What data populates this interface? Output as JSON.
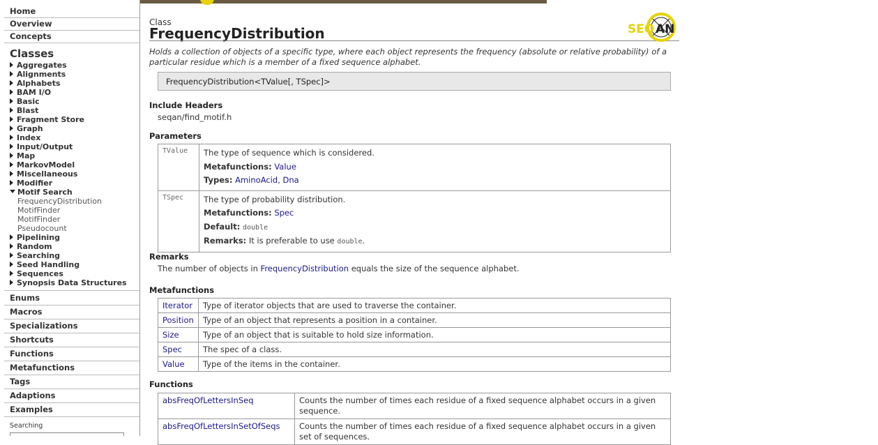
{
  "sidebar": {
    "top": [
      "Home",
      "Overview",
      "Concepts"
    ],
    "classes_heading": "Classes",
    "classes": [
      {
        "label": "Aggregates",
        "open": false
      },
      {
        "label": "Alignments",
        "open": false
      },
      {
        "label": "Alphabets",
        "open": false
      },
      {
        "label": "BAM I/O",
        "open": false
      },
      {
        "label": "Basic",
        "open": false
      },
      {
        "label": "Blast",
        "open": false
      },
      {
        "label": "Fragment Store",
        "open": false
      },
      {
        "label": "Graph",
        "open": false
      },
      {
        "label": "Index",
        "open": false
      },
      {
        "label": "Input/Output",
        "open": false
      },
      {
        "label": "Map",
        "open": false
      },
      {
        "label": "MarkovModel",
        "open": false
      },
      {
        "label": "Miscellaneous",
        "open": false
      },
      {
        "label": "Modifier",
        "open": false
      },
      {
        "label": "Motif Search",
        "open": true
      },
      {
        "label": "Pipelining",
        "open": false
      },
      {
        "label": "Random",
        "open": false
      },
      {
        "label": "Searching",
        "open": false
      },
      {
        "label": "Seed Handling",
        "open": false
      },
      {
        "label": "Sequences",
        "open": false
      },
      {
        "label": "Synopsis Data Structures",
        "open": false
      }
    ],
    "motif_children": [
      "FrequencyDistribution",
      "MotifFinder",
      "MotifFinder",
      "Pseudocount"
    ],
    "bottom": [
      "Enums",
      "Macros",
      "Specializations",
      "Shortcuts",
      "Functions",
      "Metafunctions",
      "Tags",
      "Adaptions",
      "Examples"
    ],
    "search_label": "Searching"
  },
  "page": {
    "kind": "Class",
    "title": "FrequencyDistribution",
    "logo_text": "SEQAN",
    "description": "Holds a collection of objects of a specific type, where each object represents the frequency (absolute or relative probability) of a particular residue which is a member of a fixed sequence alphabet.",
    "signature": "FrequencyDistribution<TValue[, TSpec]>",
    "include_heading": "Include Headers",
    "include_value": "seqan/find_motif.h",
    "params_heading": "Parameters",
    "params": {
      "tvalue": {
        "name": "TValue",
        "desc": "The type of sequence which is considered.",
        "mf_label": "Metafunctions:",
        "mf_link": "Value",
        "types_label": "Types:",
        "type1": "AminoAcid",
        "sep": ", ",
        "type2": "Dna"
      },
      "tspec": {
        "name": "TSpec",
        "desc": "The type of probability distribution.",
        "mf_label": "Metafunctions:",
        "mf_link": "Spec",
        "default_label": "Default:",
        "default_value": "double",
        "remarks_label": "Remarks:",
        "remarks_text": "It is preferable to use",
        "remarks_code": "double",
        "remarks_end": "."
      }
    },
    "remarks_heading": "Remarks",
    "remarks": {
      "before": "The number of objects in",
      "link": "FrequencyDistribution",
      "after": "equals the size of the sequence alphabet."
    },
    "metafunctions_heading": "Metafunctions",
    "metafunctions": [
      {
        "name": "Iterator",
        "desc": "Type of iterator objects that are used to traverse the container."
      },
      {
        "name": "Position",
        "desc": "Type of an object that represents a position in a container."
      },
      {
        "name": "Size",
        "desc": "Type of an object that is suitable to hold size information."
      },
      {
        "name": "Spec",
        "desc": "The spec of a class."
      },
      {
        "name": "Value",
        "desc": "Type of the items in the container."
      }
    ],
    "functions_heading": "Functions",
    "functions": [
      {
        "name": "absFreqOfLettersInSeq",
        "desc": "Counts the number of times each residue of a fixed sequence alphabet occurs in a given sequence."
      },
      {
        "name": "absFreqOfLettersInSetOfSeqs",
        "desc": "Counts the number of times each residue of a fixed sequence alphabet occurs in a given set of sequences."
      }
    ]
  }
}
